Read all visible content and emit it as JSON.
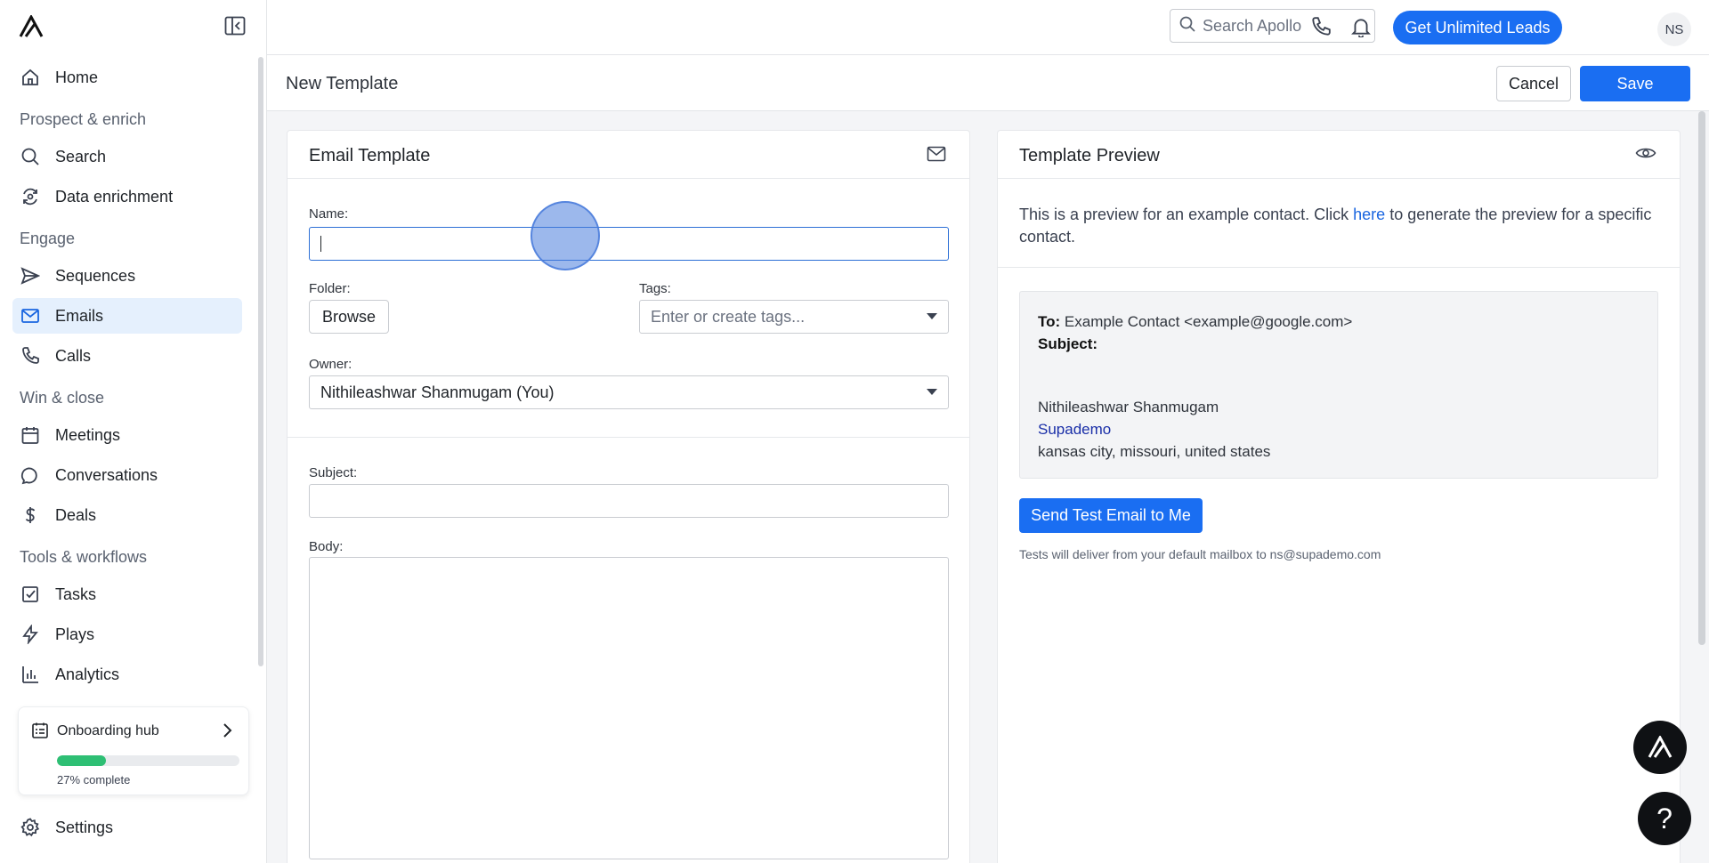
{
  "sidebar": {
    "home": "Home",
    "section_prospect": "Prospect & enrich",
    "search": "Search",
    "data_enrichment": "Data enrichment",
    "section_engage": "Engage",
    "sequences": "Sequences",
    "emails": "Emails",
    "calls": "Calls",
    "section_win": "Win & close",
    "meetings": "Meetings",
    "conversations": "Conversations",
    "deals": "Deals",
    "section_tools": "Tools & workflows",
    "tasks": "Tasks",
    "plays": "Plays",
    "analytics": "Analytics",
    "settings": "Settings",
    "active_item": "Emails"
  },
  "onboarding": {
    "title": "Onboarding hub",
    "progress_text": "27% complete",
    "progress_fraction": 0.27
  },
  "topbar": {
    "search_placeholder": "Search Apollo",
    "cta_label": "Get Unlimited Leads",
    "avatar_initials": "NS"
  },
  "page": {
    "title": "New Template",
    "cancel_label": "Cancel",
    "save_label": "Save"
  },
  "email_template": {
    "title": "Email Template",
    "name_label": "Name:",
    "name_value": "",
    "folder_label": "Folder:",
    "browse_label": "Browse",
    "tags_label": "Tags:",
    "tags_placeholder": "Enter or create tags...",
    "owner_label": "Owner:",
    "owner_value": "Nithileashwar Shanmugam (You)",
    "subject_label": "Subject:",
    "subject_value": "",
    "body_label": "Body:",
    "body_value": ""
  },
  "preview": {
    "title": "Template Preview",
    "note_before": "This is a preview for an example contact. Click ",
    "note_link": "here",
    "note_after": " to generate the preview for a specific contact.",
    "to_label": "To:",
    "to_value": " Example Contact <example@google.com>",
    "subject_label": "Subject:",
    "sender_name": "Nithileashwar Shanmugam",
    "sender_company": "Supademo",
    "sender_location": "kansas city, missouri, united states",
    "send_test_label": "Send Test Email to Me",
    "send_note": "Tests will deliver from your default mailbox to ns@supademo.com"
  },
  "help": {
    "label": "?"
  },
  "colors": {
    "primary": "#1a6ef2",
    "active_bg": "#e5f0fd",
    "progress": "#2ebf74"
  }
}
